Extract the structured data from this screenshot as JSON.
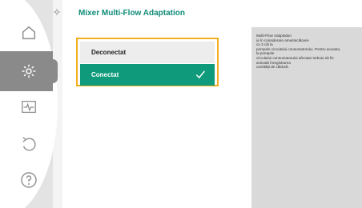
{
  "title": "Mixer Multi-Flow Adaptation",
  "options": [
    {
      "label": "Deconectat",
      "selected": false
    },
    {
      "label": "Conectat",
      "selected": true
    }
  ],
  "help_lines": [
    "Multi-Flow Adaptation",
    "ia în considerare amestecătoare",
    "cu 3 căi la",
    "pompele circuitului consumatorului. Pentru aceasta,",
    "la pompele",
    "circuitului consumatorului afectate trebuie să fie",
    "activată înregistrarea",
    "cantității de căldură."
  ],
  "icons": [
    "home-icon",
    "settings-icon",
    "monitor-icon",
    "undo-icon",
    "help-icon",
    "settings-gear-small-icon",
    "checkmark-icon"
  ],
  "colors": {
    "accent_green": "#0f9a7c",
    "title_green": "#0f8b78",
    "focus_orange": "#f6ad1d"
  }
}
